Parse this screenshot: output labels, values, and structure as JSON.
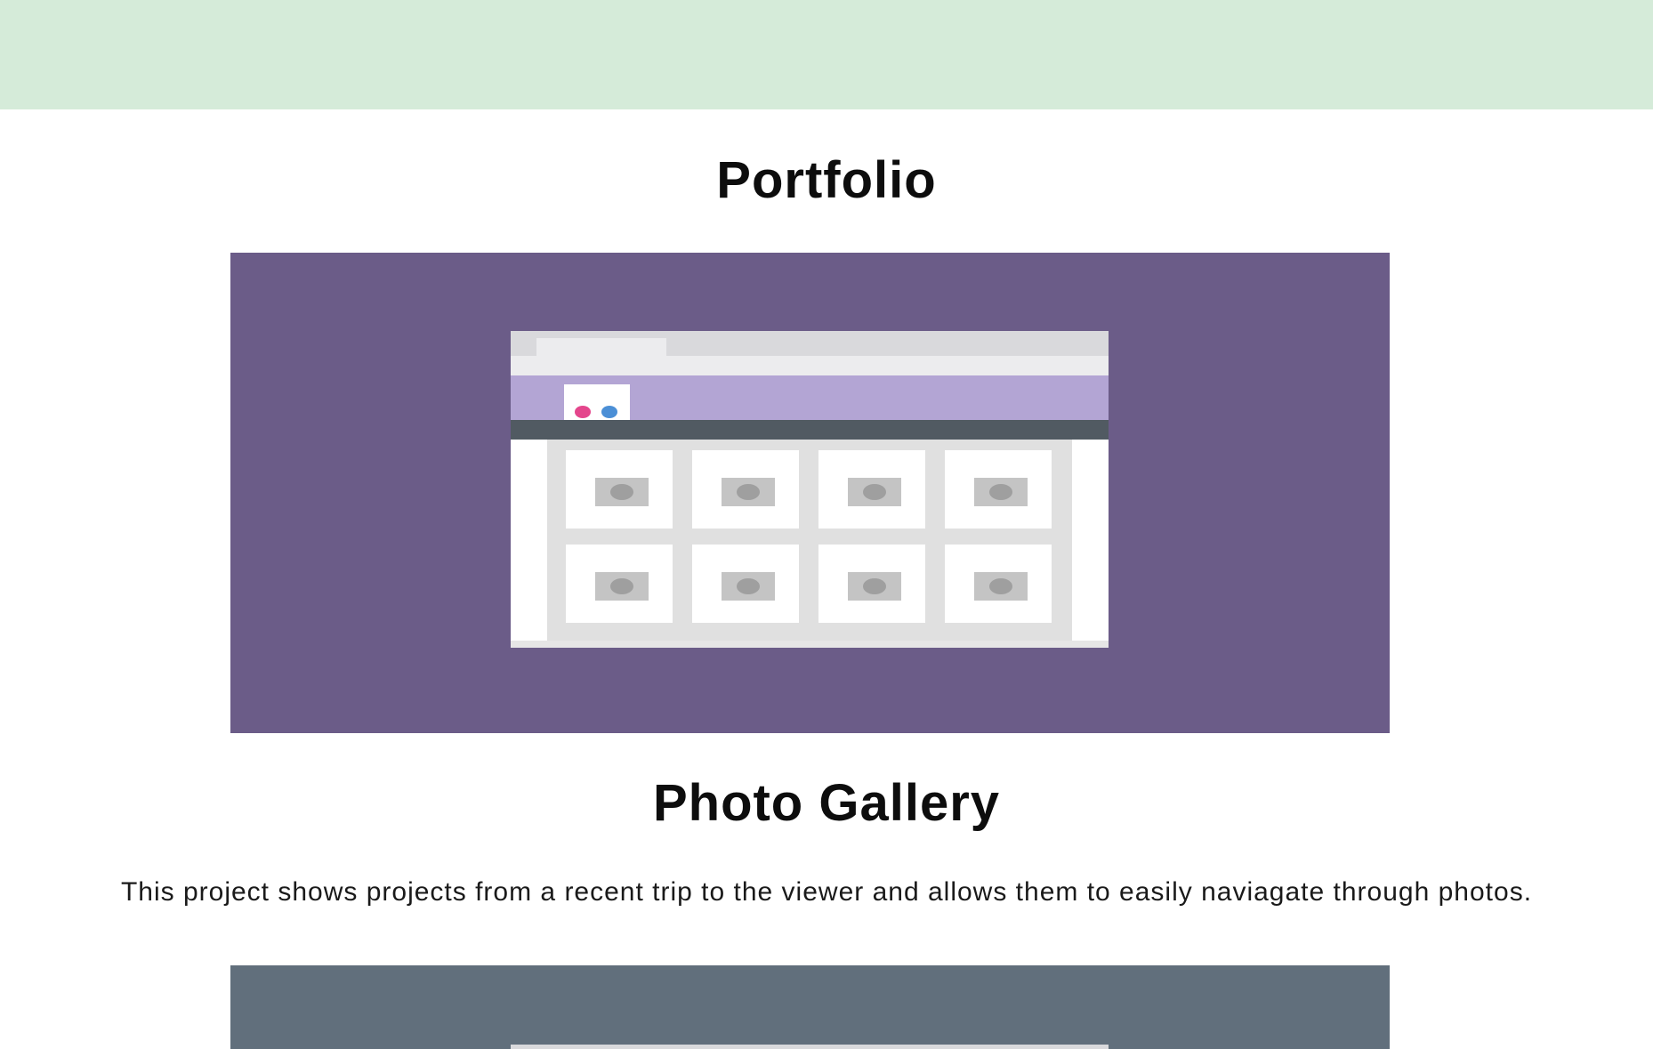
{
  "portfolio": {
    "title": "Portfolio",
    "hero_color": "#6b5c88"
  },
  "gallery": {
    "title": "Photo Gallery",
    "description": "This project shows projects from a recent trip to the viewer and allows them to easily naviagate through photos.",
    "hero_color": "#616f7c"
  },
  "banner_color": "#d5ebd9",
  "mockup": {
    "header_color": "#b3a5d4",
    "nav_color": "#515a62",
    "logo_dot_colors": [
      "#e4468c",
      "#4b8fd6"
    ],
    "thumbnail_icon": "image-placeholder-icon"
  }
}
